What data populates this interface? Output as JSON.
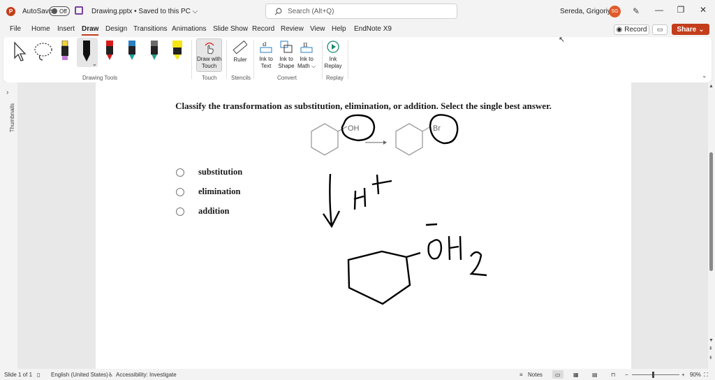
{
  "titlebar": {
    "autosave_label": "AutoSave",
    "toggle_state": "Off",
    "doc_title": "Drawing.pptx • Saved to this PC ⌵",
    "search_placeholder": "Search (Alt+Q)",
    "user_name": "Sereda, Grigoriy A",
    "avatar_initials": "SG"
  },
  "tabs": [
    "File",
    "Home",
    "Insert",
    "Draw",
    "Design",
    "Transitions",
    "Animations",
    "Slide Show",
    "Record",
    "Review",
    "View",
    "Help",
    "EndNote X9"
  ],
  "active_tab": "Draw",
  "actions": {
    "record_label": "Record",
    "share_label": "Share"
  },
  "ribbon": {
    "groups": {
      "drawing_tools": "Drawing Tools",
      "touch": "Touch",
      "stencils": "Stencils",
      "convert": "Convert",
      "replay": "Replay"
    },
    "draw_with_touch": "Draw with Touch",
    "ruler": "Ruler",
    "ink_to_text": "Ink to Text",
    "ink_to_shape": "Ink to Shape",
    "ink_to_math": "Ink to Math ⌵",
    "ink_replay": "Ink Replay",
    "pen_colors": [
      "#f2d33c",
      "#111111",
      "#d81b1b",
      "#2a7fc0",
      "#6a6a6a",
      "#f5e616"
    ]
  },
  "sidebar": {
    "thumbnails_label": "Thumbnails"
  },
  "slide": {
    "question": "Classify the transformation as substitution, elimination, or addition. Select the single best answer.",
    "options": [
      "substitution",
      "elimination",
      "addition"
    ],
    "reactant_label": "OH",
    "product_label": "Br"
  },
  "status": {
    "slide_count": "Slide 1 of 1",
    "language": "English (United States)",
    "accessibility": "Accessibility: Investigate",
    "notes": "Notes",
    "zoom": "90%"
  },
  "colors": {
    "accent": "#c43e1c",
    "ink": "#000000"
  }
}
